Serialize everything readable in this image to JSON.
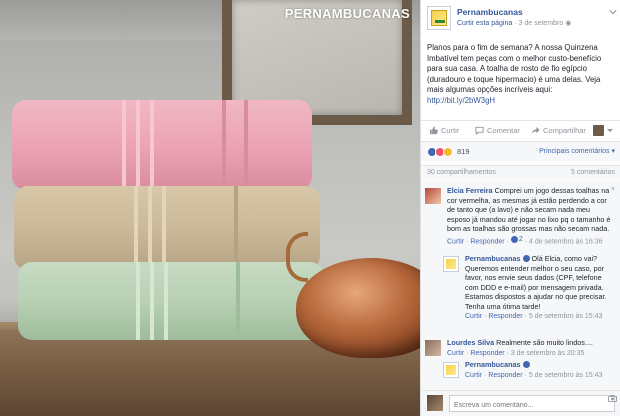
{
  "photo": {
    "brand_text": "PERNAMBUCANAS"
  },
  "post": {
    "page_name": "Pernambucanas",
    "like_page_label": "Curtir esta página",
    "separator": "·",
    "date": "3 de setembro",
    "text": "Planos para o fim de semana? A nossa Quinzena Imbatível tem peças com o melhor custo-benefício para sua casa. A toalha de rosto de fio egípcio (duradouro e toque hipermacio) é uma delas. Veja mais algumas opções incríveis aqui:",
    "url": "http://bit.ly/2bW3gH"
  },
  "actions": {
    "like": "Curtir",
    "comment": "Comentar",
    "share": "Compartilhar"
  },
  "reactions": {
    "count": "819",
    "sort_label": "Principais comentários"
  },
  "counts": {
    "shares": "30 compartilhamentos",
    "comments": "5 comentários"
  },
  "comments": [
    {
      "author": "Elcia Ferreira",
      "text": "Comprei um jogo dessas toalhas na cor vermelha, as mesmas já estão perdendo a cor de tanto que (a lavo) e não secam nada meu esposo já mandou até jogar no lixo pq o tamanho é bom as toalhas são grossas mas não secam nada.",
      "like": "Curtir",
      "reply": "Responder",
      "likes": "2",
      "time": "4 de setembro às 16:36"
    },
    {
      "author": "Pernambucanas",
      "text": "Olá Elcia, como vai? Queremos entender melhor o seu caso, por favor, nos envie seus dados (CPF, telefone com DDD e e-mail) por mensagem privada. Estamos dispostos a ajudar no que precisar. Tenha uma ótima tarde!",
      "like": "Curtir",
      "reply": "Responder",
      "time": "5 de setembro às 15:43"
    },
    {
      "author": "Lourdes Silva",
      "text": "Realmente são muito lindos....",
      "like": "Curtir",
      "reply": "Responder",
      "time": "3 de setembro às 20:35"
    },
    {
      "author": "Pernambucanas",
      "text": "",
      "like": "Curtir",
      "reply": "Responder",
      "time": "5 de setembro às 15:43"
    }
  ],
  "write": {
    "placeholder": "Escreva um comentário..."
  },
  "colors": {
    "link": "#365899",
    "accent": "#4267b2",
    "meta": "#90949c"
  }
}
